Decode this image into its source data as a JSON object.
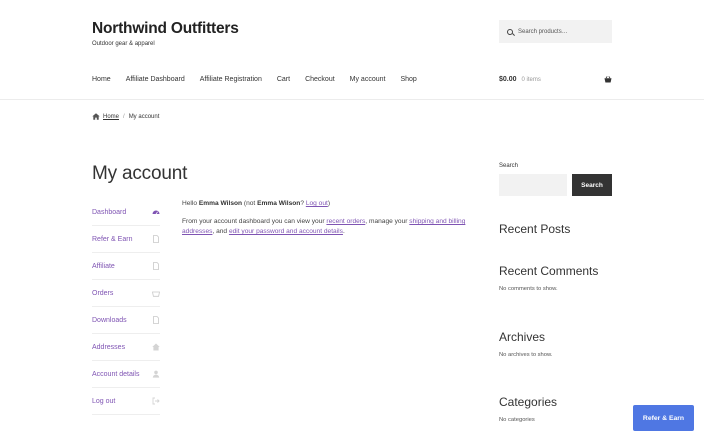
{
  "site": {
    "title": "Northwind Outfitters",
    "tagline": "Outdoor gear & apparel"
  },
  "search": {
    "placeholder": "Search products…"
  },
  "nav": {
    "items": [
      "Home",
      "Affiliate Dashboard",
      "Affiliate Registration",
      "Cart",
      "Checkout",
      "My account",
      "Shop"
    ]
  },
  "cart": {
    "total": "$0.00",
    "count": "0 items"
  },
  "breadcrumb": {
    "home": "Home",
    "separator": "/",
    "current": "My account"
  },
  "page": {
    "title": "My account"
  },
  "account_nav": {
    "items": [
      {
        "label": "Dashboard",
        "icon": "dashboard-icon"
      },
      {
        "label": "Refer & Earn",
        "icon": "file-icon"
      },
      {
        "label": "Affiliate",
        "icon": "file-icon"
      },
      {
        "label": "Orders",
        "icon": "basket-icon"
      },
      {
        "label": "Downloads",
        "icon": "file-icon"
      },
      {
        "label": "Addresses",
        "icon": "home-icon"
      },
      {
        "label": "Account details",
        "icon": "user-icon"
      },
      {
        "label": "Log out",
        "icon": "logout-icon"
      }
    ]
  },
  "dashboard": {
    "hello": "Hello",
    "user": "Emma Wilson",
    "not_open": "(not",
    "not_user": "Emma Wilson",
    "q": "?",
    "logout": "Log out",
    "close": ")",
    "p2_a": "From your account dashboard you can view your",
    "recent_orders": "recent orders",
    "p2_b": ", manage your",
    "addresses": "shipping and billing addresses",
    "p2_c": ", and",
    "account_details": "edit your password and account details",
    "p2_d": "."
  },
  "sidebar": {
    "search_label": "Search",
    "search_button": "Search",
    "recent_posts": "Recent Posts",
    "recent_comments": "Recent Comments",
    "no_comments": "No comments to show.",
    "archives": "Archives",
    "no_archives": "No archives to show.",
    "categories": "Categories",
    "no_categories": "No categories"
  },
  "floating": {
    "label": "Refer & Earn"
  },
  "colors": {
    "accent": "#7f54b3",
    "button_dark": "#333333",
    "floating_button": "#4f77e3"
  }
}
